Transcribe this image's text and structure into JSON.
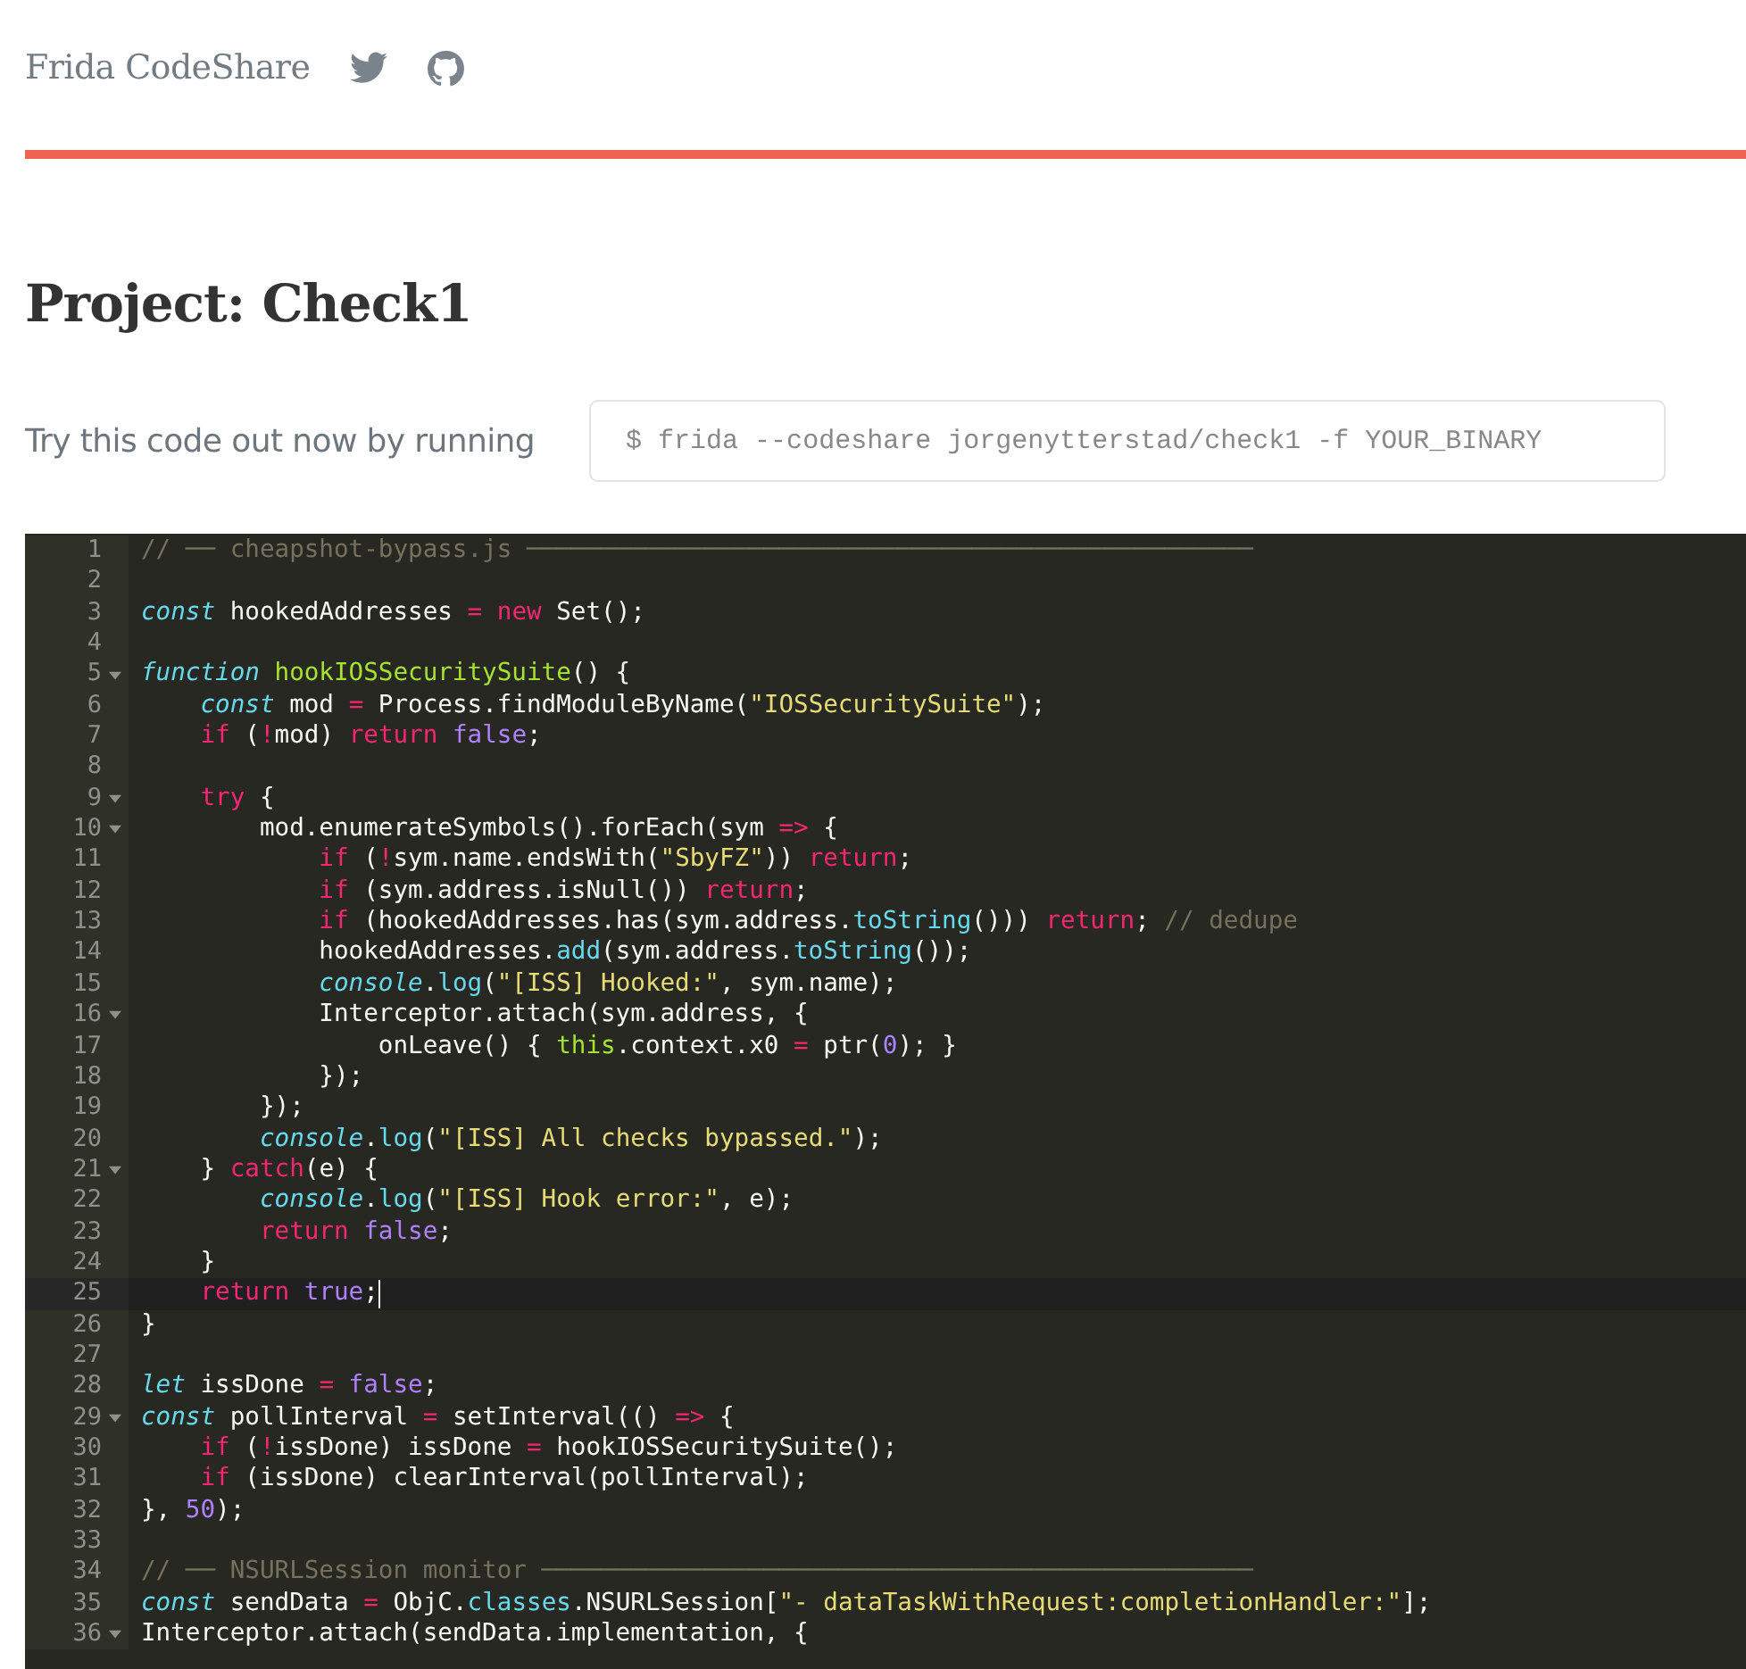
{
  "site": {
    "title": "Frida CodeShare"
  },
  "project": {
    "heading": "Project: Check1"
  },
  "run": {
    "label": "Try this code out now by running",
    "command": "$ frida --codeshare jorgenytterstad/check1 -f YOUR_BINARY"
  },
  "editor": {
    "lines": [
      {
        "number": "1",
        "foldable": false,
        "active": false,
        "tokens": [
          {
            "kind": "comment",
            "text": "// ── cheapshot-bypass.js ─────────────────────────────────────────────────"
          }
        ]
      },
      {
        "number": "2",
        "foldable": false,
        "active": false
      },
      {
        "number": "3",
        "foldable": false,
        "active": false,
        "tokens": [
          {
            "kind": "storage",
            "text": "const"
          },
          {
            "kind": "plain",
            "text": " hookedAddresses "
          },
          {
            "kind": "keyword",
            "text": "="
          },
          {
            "kind": "keyword",
            "text": " new"
          },
          {
            "kind": "plain",
            "text": " Set();"
          }
        ]
      },
      {
        "number": "4",
        "foldable": false,
        "active": false
      },
      {
        "number": "5",
        "foldable": true,
        "active": false,
        "tokens": [
          {
            "kind": "storage",
            "text": "function"
          },
          {
            "kind": "function",
            "text": " hookIOSSecuritySuite"
          },
          {
            "kind": "plain",
            "text": "() {"
          }
        ]
      },
      {
        "number": "6",
        "foldable": false,
        "active": false,
        "tokens": [
          {
            "kind": "storage",
            "text": "    const"
          },
          {
            "kind": "plain",
            "text": " mod "
          },
          {
            "kind": "keyword",
            "text": "="
          },
          {
            "kind": "plain",
            "text": " Process.findModuleByName("
          },
          {
            "kind": "string",
            "text": "\"IOSSecuritySuite\""
          },
          {
            "kind": "plain",
            "text": ");"
          }
        ]
      },
      {
        "number": "7",
        "foldable": false,
        "active": false,
        "tokens": [
          {
            "kind": "keyword",
            "text": "    if"
          },
          {
            "kind": "plain",
            "text": " ("
          },
          {
            "kind": "keyword",
            "text": "!"
          },
          {
            "kind": "plain",
            "text": "mod) "
          },
          {
            "kind": "keyword",
            "text": "return"
          },
          {
            "kind": "constant",
            "text": " false"
          },
          {
            "kind": "plain",
            "text": ";"
          }
        ]
      },
      {
        "number": "8",
        "foldable": false,
        "active": false
      },
      {
        "number": "9",
        "foldable": true,
        "active": false,
        "tokens": [
          {
            "kind": "keyword",
            "text": "    try"
          },
          {
            "kind": "plain",
            "text": " {"
          }
        ]
      },
      {
        "number": "10",
        "foldable": true,
        "active": false,
        "tokens": [
          {
            "kind": "plain",
            "text": "        mod.enumerateSymbols().forEach(sym "
          },
          {
            "kind": "keyword",
            "text": "=>"
          },
          {
            "kind": "plain",
            "text": " {"
          }
        ]
      },
      {
        "number": "11",
        "foldable": false,
        "active": false,
        "tokens": [
          {
            "kind": "keyword",
            "text": "            if"
          },
          {
            "kind": "plain",
            "text": " ("
          },
          {
            "kind": "keyword",
            "text": "!"
          },
          {
            "kind": "plain",
            "text": "sym.name.endsWith("
          },
          {
            "kind": "string",
            "text": "\"SbyFZ\""
          },
          {
            "kind": "plain",
            "text": ")) "
          },
          {
            "kind": "keyword",
            "text": "return"
          },
          {
            "kind": "plain",
            "text": ";"
          }
        ]
      },
      {
        "number": "12",
        "foldable": false,
        "active": false,
        "tokens": [
          {
            "kind": "keyword",
            "text": "            if"
          },
          {
            "kind": "plain",
            "text": " (sym.address.isNull()) "
          },
          {
            "kind": "keyword",
            "text": "return"
          },
          {
            "kind": "plain",
            "text": ";"
          }
        ]
      },
      {
        "number": "13",
        "foldable": false,
        "active": false,
        "tokens": [
          {
            "kind": "keyword",
            "text": "            if"
          },
          {
            "kind": "plain",
            "text": " (hookedAddresses.has(sym.address."
          },
          {
            "kind": "support",
            "text": "toString"
          },
          {
            "kind": "plain",
            "text": "())) "
          },
          {
            "kind": "keyword",
            "text": "return"
          },
          {
            "kind": "plain",
            "text": ";"
          },
          {
            "kind": "comment",
            "text": " // dedupe"
          }
        ]
      },
      {
        "number": "14",
        "foldable": false,
        "active": false,
        "tokens": [
          {
            "kind": "plain",
            "text": "            hookedAddresses."
          },
          {
            "kind": "support",
            "text": "add"
          },
          {
            "kind": "plain",
            "text": "(sym.address."
          },
          {
            "kind": "support",
            "text": "toString"
          },
          {
            "kind": "plain",
            "text": "());"
          }
        ]
      },
      {
        "number": "15",
        "foldable": false,
        "active": false,
        "tokens": [
          {
            "kind": "builtin",
            "text": "            console"
          },
          {
            "kind": "plain",
            "text": "."
          },
          {
            "kind": "support",
            "text": "log"
          },
          {
            "kind": "plain",
            "text": "("
          },
          {
            "kind": "string",
            "text": "\"[ISS] Hooked:\""
          },
          {
            "kind": "plain",
            "text": ", sym.name);"
          }
        ]
      },
      {
        "number": "16",
        "foldable": true,
        "active": false,
        "tokens": [
          {
            "kind": "plain",
            "text": "            Interceptor.attach(sym.address, {"
          }
        ]
      },
      {
        "number": "17",
        "foldable": false,
        "active": false,
        "tokens": [
          {
            "kind": "plain",
            "text": "                onLeave() { "
          },
          {
            "kind": "function",
            "text": "this"
          },
          {
            "kind": "plain",
            "text": ".context.x0 "
          },
          {
            "kind": "keyword",
            "text": "="
          },
          {
            "kind": "plain",
            "text": " ptr("
          },
          {
            "kind": "constant",
            "text": "0"
          },
          {
            "kind": "plain",
            "text": "); }"
          }
        ]
      },
      {
        "number": "18",
        "foldable": false,
        "active": false,
        "tokens": [
          {
            "kind": "plain",
            "text": "            });"
          }
        ]
      },
      {
        "number": "19",
        "foldable": false,
        "active": false,
        "tokens": [
          {
            "kind": "plain",
            "text": "        });"
          }
        ]
      },
      {
        "number": "20",
        "foldable": false,
        "active": false,
        "tokens": [
          {
            "kind": "builtin",
            "text": "        console"
          },
          {
            "kind": "plain",
            "text": "."
          },
          {
            "kind": "support",
            "text": "log"
          },
          {
            "kind": "plain",
            "text": "("
          },
          {
            "kind": "string",
            "text": "\"[ISS] All checks bypassed.\""
          },
          {
            "kind": "plain",
            "text": ");"
          }
        ]
      },
      {
        "number": "21",
        "foldable": true,
        "active": false,
        "tokens": [
          {
            "kind": "plain",
            "text": "    } "
          },
          {
            "kind": "keyword",
            "text": "catch"
          },
          {
            "kind": "plain",
            "text": "(e) {"
          }
        ]
      },
      {
        "number": "22",
        "foldable": false,
        "active": false,
        "tokens": [
          {
            "kind": "builtin",
            "text": "        console"
          },
          {
            "kind": "plain",
            "text": "."
          },
          {
            "kind": "support",
            "text": "log"
          },
          {
            "kind": "plain",
            "text": "("
          },
          {
            "kind": "string",
            "text": "\"[ISS] Hook error:\""
          },
          {
            "kind": "plain",
            "text": ", e);"
          }
        ]
      },
      {
        "number": "23",
        "foldable": false,
        "active": false,
        "tokens": [
          {
            "kind": "keyword",
            "text": "        return"
          },
          {
            "kind": "constant",
            "text": " false"
          },
          {
            "kind": "plain",
            "text": ";"
          }
        ]
      },
      {
        "number": "24",
        "foldable": false,
        "active": false,
        "tokens": [
          {
            "kind": "plain",
            "text": "    }"
          }
        ]
      },
      {
        "number": "25",
        "foldable": false,
        "active": true,
        "tokens": [
          {
            "kind": "keyword",
            "text": "    return"
          },
          {
            "kind": "constant",
            "text": " true"
          },
          {
            "kind": "plain",
            "text": ";"
          }
        ]
      },
      {
        "number": "26",
        "foldable": false,
        "active": false,
        "tokens": [
          {
            "kind": "plain",
            "text": "}"
          }
        ]
      },
      {
        "number": "27",
        "foldable": false,
        "active": false
      },
      {
        "number": "28",
        "foldable": false,
        "active": false,
        "tokens": [
          {
            "kind": "storage",
            "text": "let"
          },
          {
            "kind": "plain",
            "text": " issDone "
          },
          {
            "kind": "keyword",
            "text": "="
          },
          {
            "kind": "constant",
            "text": " false"
          },
          {
            "kind": "plain",
            "text": ";"
          }
        ]
      },
      {
        "number": "29",
        "foldable": true,
        "active": false,
        "tokens": [
          {
            "kind": "storage",
            "text": "const"
          },
          {
            "kind": "plain",
            "text": " pollInterval "
          },
          {
            "kind": "keyword",
            "text": "="
          },
          {
            "kind": "plain",
            "text": " setInterval(() "
          },
          {
            "kind": "keyword",
            "text": "=>"
          },
          {
            "kind": "plain",
            "text": " {"
          }
        ]
      },
      {
        "number": "30",
        "foldable": false,
        "active": false,
        "tokens": [
          {
            "kind": "keyword",
            "text": "    if"
          },
          {
            "kind": "plain",
            "text": " ("
          },
          {
            "kind": "keyword",
            "text": "!"
          },
          {
            "kind": "plain",
            "text": "issDone) issDone "
          },
          {
            "kind": "keyword",
            "text": "="
          },
          {
            "kind": "plain",
            "text": " hookIOSSecuritySuite();"
          }
        ]
      },
      {
        "number": "31",
        "foldable": false,
        "active": false,
        "tokens": [
          {
            "kind": "keyword",
            "text": "    if"
          },
          {
            "kind": "plain",
            "text": " (issDone) clearInterval(pollInterval);"
          }
        ]
      },
      {
        "number": "32",
        "foldable": false,
        "active": false,
        "tokens": [
          {
            "kind": "plain",
            "text": "}, "
          },
          {
            "kind": "constant",
            "text": "50"
          },
          {
            "kind": "plain",
            "text": ");"
          }
        ]
      },
      {
        "number": "33",
        "foldable": false,
        "active": false
      },
      {
        "number": "34",
        "foldable": false,
        "active": false,
        "tokens": [
          {
            "kind": "comment",
            "text": "// ── NSURLSession monitor ────────────────────────────────────────────────"
          }
        ]
      },
      {
        "number": "35",
        "foldable": false,
        "active": false,
        "tokens": [
          {
            "kind": "storage",
            "text": "const"
          },
          {
            "kind": "plain",
            "text": " sendData "
          },
          {
            "kind": "keyword",
            "text": "="
          },
          {
            "kind": "plain",
            "text": " ObjC."
          },
          {
            "kind": "support",
            "text": "classes"
          },
          {
            "kind": "plain",
            "text": ".NSURLSession["
          },
          {
            "kind": "string",
            "text": "\"- dataTaskWithRequest:completionHandler:\""
          },
          {
            "kind": "plain",
            "text": "];"
          }
        ]
      },
      {
        "number": "36",
        "foldable": true,
        "active": false,
        "tokens": [
          {
            "kind": "plain",
            "text": "Interceptor.attach(sendData.implementation, {"
          }
        ]
      }
    ]
  }
}
